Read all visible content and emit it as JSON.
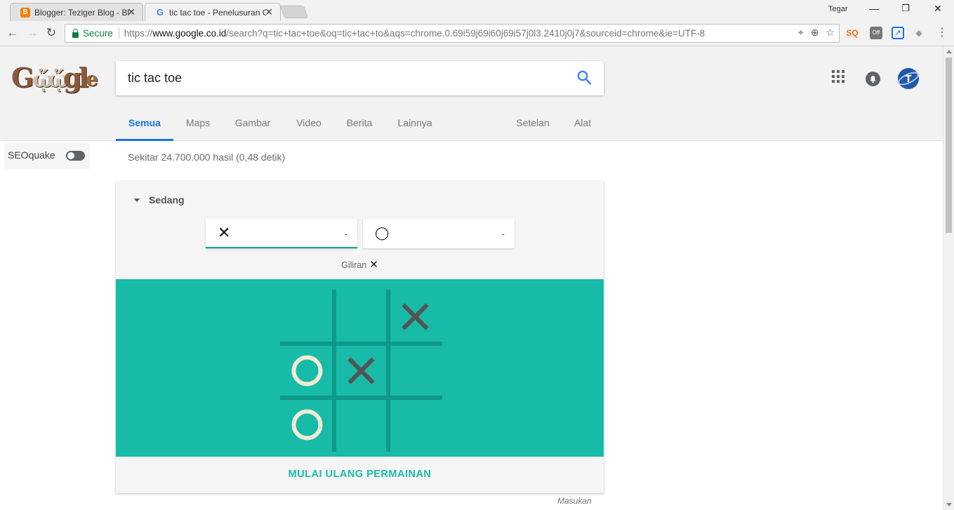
{
  "browser": {
    "tabs": [
      {
        "title": "Blogger: Teziger Blog - Bl",
        "icon": "blogger-icon",
        "active": false
      },
      {
        "title": "tic tac toe - Penelusuran G",
        "icon": "google-icon",
        "active": true
      }
    ],
    "profile_name": "Tegar",
    "address": {
      "secure_label": "Secure",
      "url_prefix": "https://",
      "url_domain": "www.google.co.id",
      "url_rest": "/search?q=tic+tac+toe&oq=tic+tac+to&aqs=chrome.0.69i59j69i60j69i57j0l3.2410j0j7&sourceid=chrome&ie=UTF-8"
    }
  },
  "google": {
    "doodle_letters": "Gugl",
    "query": "tic tac toe",
    "tabs": [
      "Semua",
      "Maps",
      "Gambar",
      "Video",
      "Berita",
      "Lainnya",
      "Setelan",
      "Alat"
    ],
    "active_tab": "Semua",
    "result_stats": "Sekitar 24.700.000 hasil (0,48 detik)",
    "seoquake_label": "SEOquake"
  },
  "game": {
    "difficulty": "Sedang",
    "players": [
      {
        "symbol": "✕",
        "score": "-",
        "active": true
      },
      {
        "symbol": "◯",
        "score": "-",
        "active": false
      }
    ],
    "turn_label": "Giliran",
    "turn_symbol": "✕",
    "board": [
      [
        "",
        "",
        "X"
      ],
      [
        "O",
        "X",
        ""
      ],
      [
        "O",
        "",
        ""
      ]
    ],
    "restart_label": "MULAI ULANG PERMAINAN",
    "feedback_label": "Masukan",
    "colors": {
      "board_bg": "#17bba8",
      "grid": "#10988a",
      "x_mark": "#545454",
      "o_mark": "#f2ebd3"
    }
  }
}
